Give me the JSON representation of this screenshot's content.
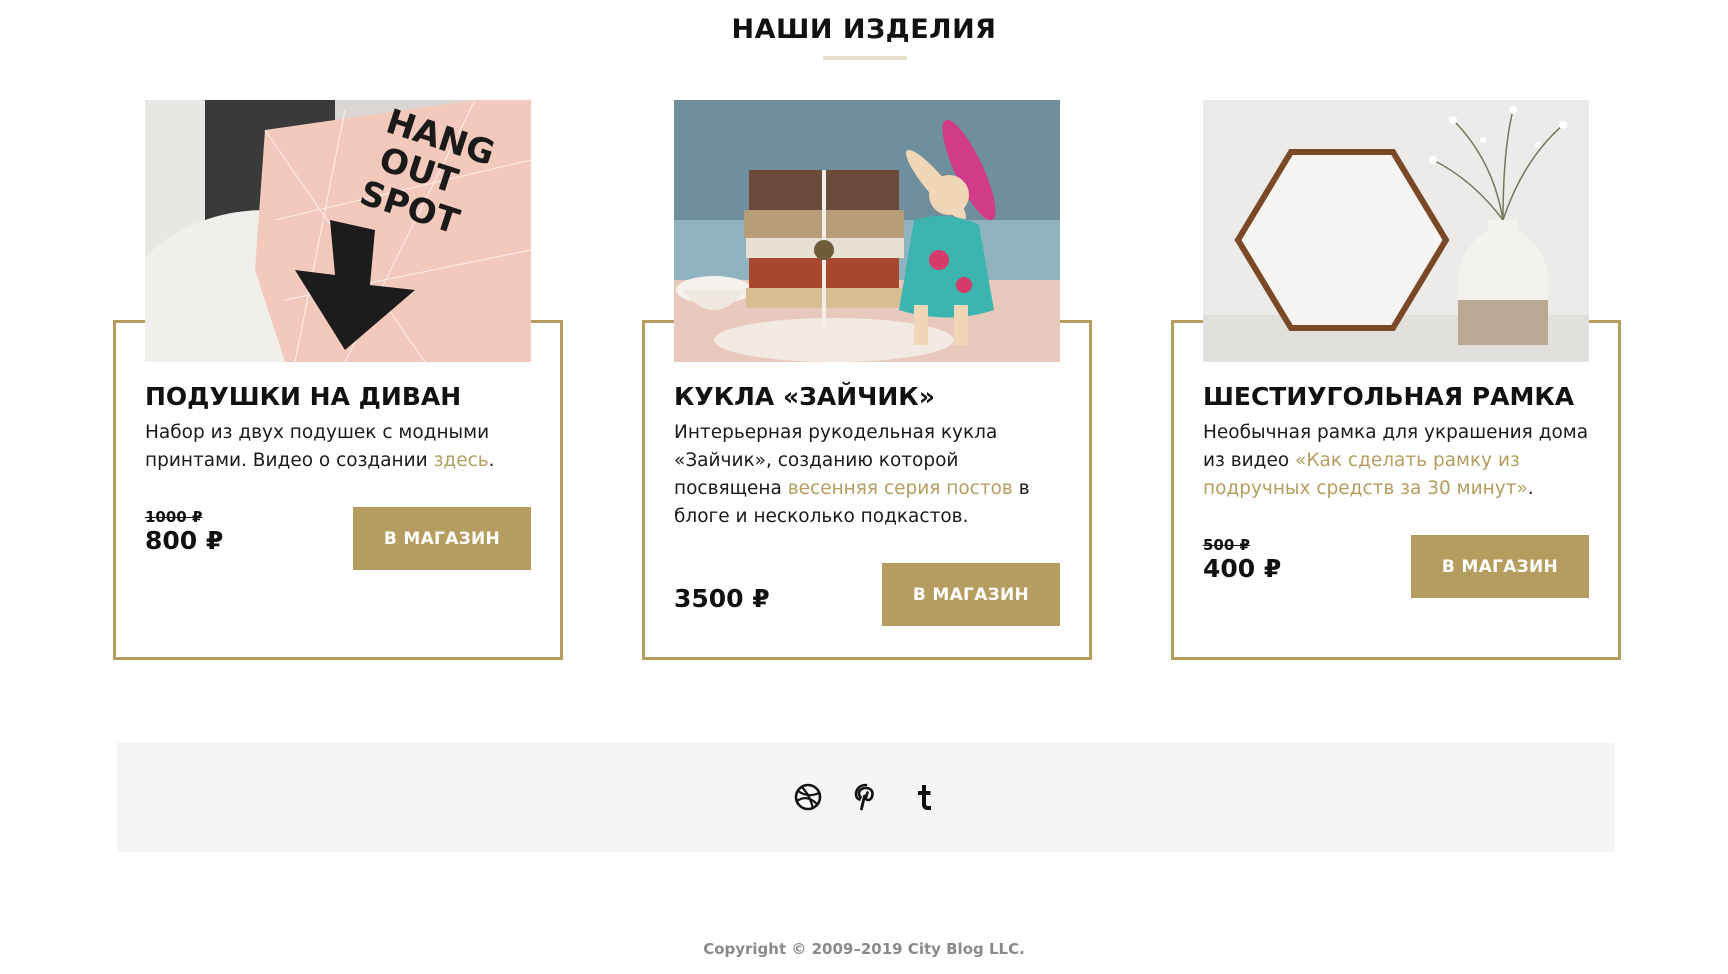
{
  "section": {
    "title": "НАШИ ИЗДЕЛИЯ"
  },
  "products": [
    {
      "title": "ПОДУШКИ НА ДИВАН",
      "desc_before": "Набор из двух подушек с модными принтами. Видео о создании ",
      "desc_link": "здесь",
      "desc_after": ".",
      "old_price": "1000 ₽",
      "price": "800 ₽",
      "button": "В МАГАЗИН",
      "image_text": [
        "HANG",
        "OUT",
        "SPOT"
      ]
    },
    {
      "title": "КУКЛА «ЗАЙЧИК»",
      "desc_before": "Интерьерная рукодельная кукла «Зайчик», созданию которой посвящена ",
      "desc_link": "весенняя серия постов",
      "desc_after": " в блоге и несколько подкастов.",
      "price": "3500 ₽",
      "button": "В МАГАЗИН"
    },
    {
      "title": "ШЕСТИУГОЛЬНАЯ РАМКА",
      "desc_before": "Необычная рамка для украшения дома из видео ",
      "desc_link": "«Как сделать рамку из подручных средств за 30 минут»",
      "desc_after": ".",
      "old_price": "500 ₽",
      "price": "400 ₽",
      "button": "В МАГАЗИН"
    }
  ],
  "social": {
    "icons": [
      "dribbble-icon",
      "pinterest-icon",
      "tumblr-icon"
    ]
  },
  "footer": {
    "copyright": "Copyright © 2009–2019 City Blog LLC."
  },
  "colors": {
    "accent": "#b49d5e",
    "underline": "#e6dfc7",
    "footer_bg": "#f4f5f4",
    "copyright": "#8a8a8a"
  }
}
